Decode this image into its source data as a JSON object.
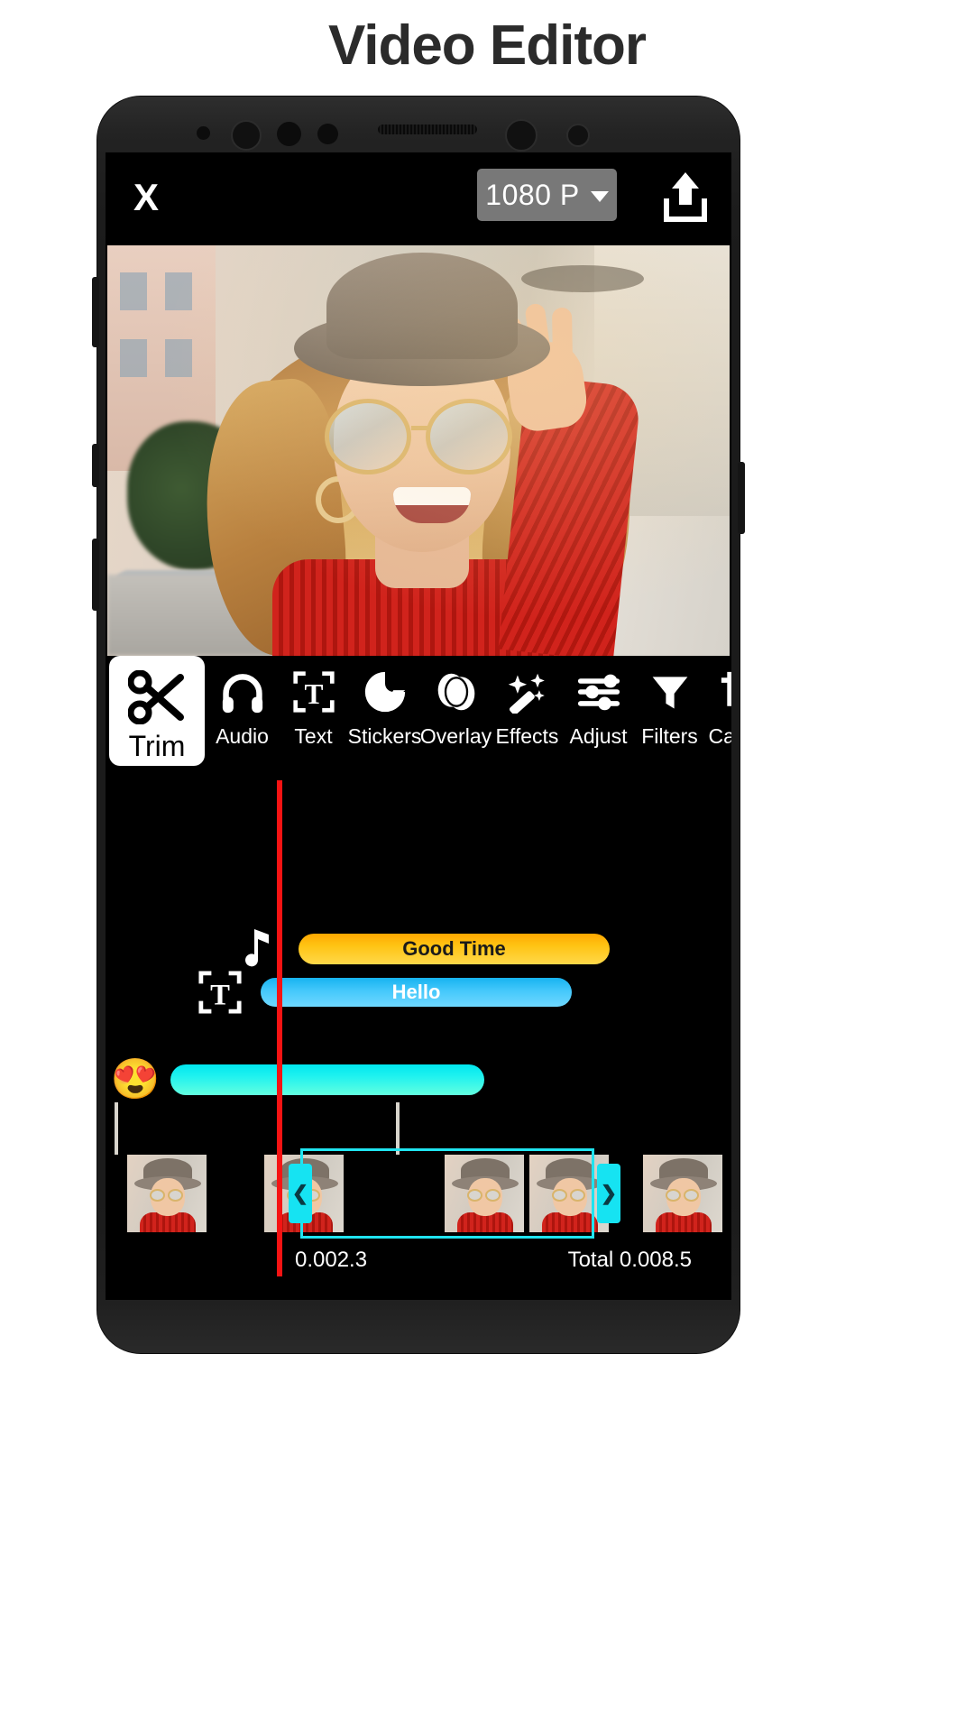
{
  "page": {
    "title": "Video Editor"
  },
  "app": {
    "topbar": {
      "close_label": "X",
      "close_icon": "close-x-icon",
      "resolution_value": "1080 P",
      "resolution_caret_icon": "chevron-down-icon",
      "share_icon": "share-export-icon"
    },
    "toolbar": {
      "items": [
        {
          "label": "Trim",
          "icon": "scissors-icon",
          "active": true
        },
        {
          "label": "Audio",
          "icon": "headphones-icon",
          "active": false
        },
        {
          "label": "Text",
          "icon": "text-box-icon",
          "active": false
        },
        {
          "label": "Stickers",
          "icon": "sticker-icon",
          "active": false
        },
        {
          "label": "Overlay",
          "icon": "overlay-icon",
          "active": false
        },
        {
          "label": "Effects",
          "icon": "magic-wand-icon",
          "active": false
        },
        {
          "label": "Adjust",
          "icon": "sliders-icon",
          "active": false
        },
        {
          "label": "Filters",
          "icon": "funnel-icon",
          "active": false
        },
        {
          "label": "Canv",
          "icon": "canvas-crop-icon",
          "active": false
        }
      ]
    },
    "timeline": {
      "tracks": [
        {
          "name": "music",
          "icon": "music-note-icon",
          "clip_label": "Good Time",
          "color": "#ffc414"
        },
        {
          "name": "text",
          "icon": "text-box-icon",
          "clip_label": "Hello",
          "color": "#45c8fb"
        },
        {
          "name": "sticker",
          "icon": "smiley-heart-eyes-icon",
          "clip_label": "",
          "color": "#21f2ef"
        }
      ],
      "playhead_color": "#f51313",
      "selection_color": "#20e4f0",
      "handle_left_icon": "chevron-left-icon",
      "handle_right_icon": "chevron-right-icon",
      "current_time": "0.002.3",
      "total_time": "Total 0.008.5"
    }
  },
  "colors": {
    "accent_cyan": "#20e4f0",
    "accent_amber": "#ffc414",
    "accent_blue": "#45c8fb",
    "playhead_red": "#f51313",
    "screen_bg": "#000000",
    "page_bg": "#ffffff"
  }
}
